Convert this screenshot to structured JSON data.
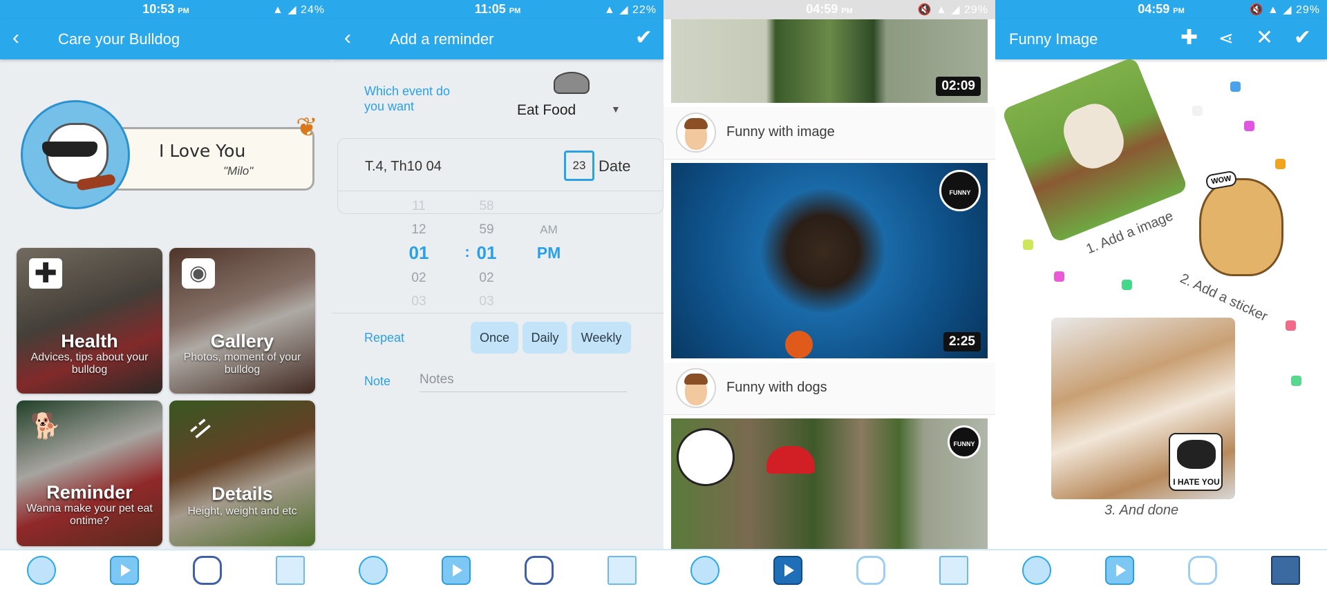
{
  "screen1": {
    "status": {
      "time": "10:53",
      "ampm": "PM",
      "icons": "▲ ◢ 24%"
    },
    "appbar": {
      "title": "Care your Bulldog",
      "back_icon": "back-arrow-icon"
    },
    "profile": {
      "message": "I Love You",
      "name": "\"Milo\""
    },
    "tiles": [
      {
        "name": "Health",
        "desc": "Advices, tips about your bulldog"
      },
      {
        "name": "Gallery",
        "desc": "Photos, moment of your bulldog"
      },
      {
        "name": "Reminder",
        "desc": "Wanna make your pet eat ontime?"
      },
      {
        "name": "Details",
        "desc": "Height, weight and etc"
      }
    ]
  },
  "screen2": {
    "status": {
      "time": "11:05",
      "ampm": "PM",
      "icons": "▲ ◢ 22%"
    },
    "appbar": {
      "title": "Add a reminder"
    },
    "event": {
      "label": "Which event do you want",
      "value": "Eat Food"
    },
    "date": {
      "value": "T.4, Th10 04",
      "calendar_day": "23",
      "label": "Date"
    },
    "time_wheel": {
      "hours": [
        "11",
        "12",
        "01",
        "02",
        "03"
      ],
      "minutes": [
        "58",
        "59",
        "01",
        "02",
        "03"
      ],
      "ampm": [
        "AM",
        "PM"
      ],
      "separator": ":"
    },
    "repeat": {
      "label": "Repeat",
      "options": [
        "Once",
        "Daily",
        "Weekly"
      ]
    },
    "note": {
      "label": "Note",
      "placeholder": "Notes"
    }
  },
  "screen3": {
    "status": {
      "time": "04:59",
      "ampm": "PM",
      "icons": "🔇 ▲ ◢ 29%"
    },
    "videos": [
      {
        "duration": "02:09"
      },
      {
        "title": "Funny with image",
        "duration": "2:25"
      },
      {
        "title": "Funny with dogs"
      }
    ]
  },
  "screen4": {
    "status": {
      "time": "04:59",
      "ampm": "PM",
      "icons": "🔇 ▲ ◢ 29%"
    },
    "appbar": {
      "title": "Funny Image"
    },
    "steps": [
      "1. Add a image",
      "2. Add a sticker",
      "3. And done"
    ],
    "stickers": {
      "wow": "WOW",
      "hate": "I HATE YOU"
    }
  },
  "colors": {
    "primary": "#2aa8ec",
    "accent_text": "#2aa0e8",
    "chip": "#c3e4f8"
  }
}
